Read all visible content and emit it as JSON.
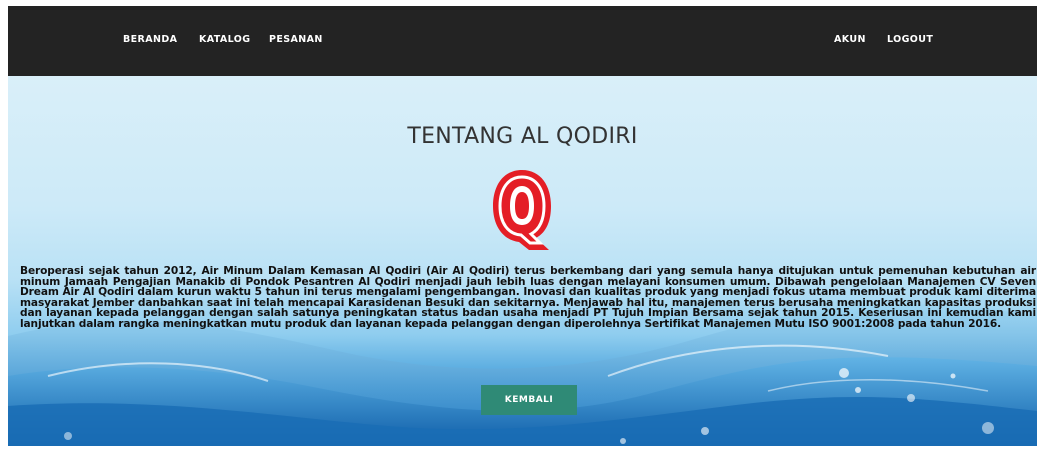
{
  "nav": {
    "left": [
      "BERANDA",
      "KATALOG",
      "PESANAN"
    ],
    "right": [
      "AKUN",
      "LOGOUT"
    ],
    "background": "#232323"
  },
  "main": {
    "title": "TENTANG AL QODIRI",
    "logo": {
      "icon": "al-qodiri-q-logo",
      "color": "#e41e26"
    },
    "description": "Beroperasi sejak tahun 2012, Air Minum Dalam Kemasan Al Qodiri (Air Al Qodiri) terus berkembang dari yang semula hanya ditujukan untuk pemenuhan kebutuhan air minum Jamaah Pengajian Manakib di Pondok Pesantren Al Qodiri menjadi jauh lebih luas dengan melayani konsumen umum. Dibawah pengelolaan Manajemen CV Seven Dream Air Al Qodiri dalam kurun waktu 5 tahun ini terus mengalami pengembangan. Inovasi dan kualitas produk yang menjadi fokus utama membuat produk kami diterima masyarakat Jember danbahkan saat ini telah mencapai Karasidenan Besuki dan sekitarnya. Menjawab hal itu, manajemen terus berusaha meningkatkan kapasitas produksi dan layanan kepada pelanggan dengan salah satunya peningkatan status badan usaha menjadi PT Tujuh Impian Bersama sejak tahun 2015. Keseriusan ini kemudian kami lanjutkan dalam rangka meningkatkan mutu produk dan layanan kepada pelanggan dengan diperolehnya Sertifikat Manajemen Mutu ISO 9001:2008 pada tahun 2016.",
    "back_button": "KEMBALI",
    "button_color": "#2f8a76"
  }
}
